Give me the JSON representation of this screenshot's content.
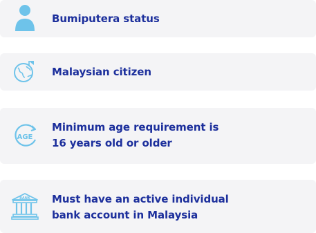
{
  "requirements": [
    {
      "icon": "person-icon",
      "text": "Bumiputera status"
    },
    {
      "icon": "globe-icon",
      "text": "Malaysian citizen"
    },
    {
      "icon": "age-icon",
      "icon_text": "AGE",
      "line1": "Minimum age requirement is",
      "line2": "16 years old or older"
    },
    {
      "icon": "bank-icon",
      "icon_text": "BANK",
      "line1": "Must have an active individual",
      "line2": "bank account in Malaysia"
    }
  ],
  "colors": {
    "accent": "#1c2f9c",
    "icon": "#6ec3ea",
    "card": "#f4f4f6"
  }
}
